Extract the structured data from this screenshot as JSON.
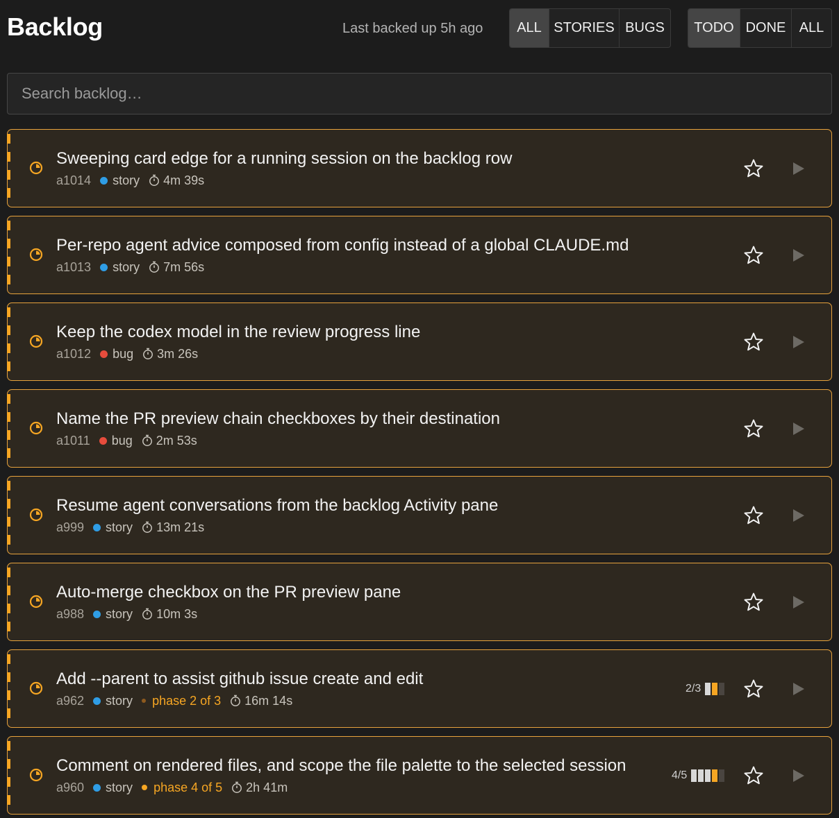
{
  "header": {
    "title": "Backlog",
    "backup_status": "Last backed up 5h ago",
    "type_filter": [
      {
        "label": "ALL",
        "active": true
      },
      {
        "label": "STORIES",
        "active": false
      },
      {
        "label": "BUGS",
        "active": false
      }
    ],
    "state_filter": [
      {
        "label": "TODO",
        "active": true
      },
      {
        "label": "DONE",
        "active": false
      },
      {
        "label": "ALL",
        "active": false
      }
    ]
  },
  "search": {
    "placeholder": "Search backlog…",
    "value": ""
  },
  "colors": {
    "card_border": "#e8a33d",
    "card_bg": "#2e281f",
    "running_accent": "#f6a623",
    "story_dot": "#2f9de5",
    "bug_dot": "#e74c3c"
  },
  "items": [
    {
      "title": "Sweeping card edge for a running session on the backlog row",
      "id": "a1014",
      "kind": "story",
      "timer": "4m 39s",
      "phase": null,
      "progress": null,
      "status_icon": "running-clock-icon"
    },
    {
      "title": "Per-repo agent advice composed from config instead of a global CLAUDE.md",
      "id": "a1013",
      "kind": "story",
      "timer": "7m 56s",
      "phase": null,
      "progress": null,
      "status_icon": "running-clock-icon"
    },
    {
      "title": "Keep the codex model in the review progress line",
      "id": "a1012",
      "kind": "bug",
      "timer": "3m 26s",
      "phase": null,
      "progress": null,
      "status_icon": "running-clock-icon"
    },
    {
      "title": "Name the PR preview chain checkboxes by their destination",
      "id": "a1011",
      "kind": "bug",
      "timer": "2m 53s",
      "phase": null,
      "progress": null,
      "status_icon": "running-clock-icon"
    },
    {
      "title": "Resume agent conversations from the backlog Activity pane",
      "id": "a999",
      "kind": "story",
      "timer": "13m 21s",
      "phase": null,
      "progress": null,
      "status_icon": "running-clock-icon"
    },
    {
      "title": "Auto-merge checkbox on the PR preview pane",
      "id": "a988",
      "kind": "story",
      "timer": "10m 3s",
      "phase": null,
      "progress": null,
      "status_icon": "running-clock-icon"
    },
    {
      "title": "Add --parent to assist github issue create and edit",
      "id": "a962",
      "kind": "story",
      "timer": "16m 14s",
      "phase": "phase 2 of 3",
      "phase_dot": "dim",
      "progress": {
        "label": "2/3",
        "done": 1,
        "current": 1,
        "total": 3
      },
      "status_icon": "running-clock-icon"
    },
    {
      "title": "Comment on rendered files, and scope the file palette to the selected session",
      "id": "a960",
      "kind": "story",
      "timer": "2h 41m",
      "phase": "phase 4 of 5",
      "phase_dot": "bright",
      "progress": {
        "label": "4/5",
        "done": 3,
        "current": 1,
        "total": 5
      },
      "status_icon": "running-clock-icon"
    }
  ]
}
